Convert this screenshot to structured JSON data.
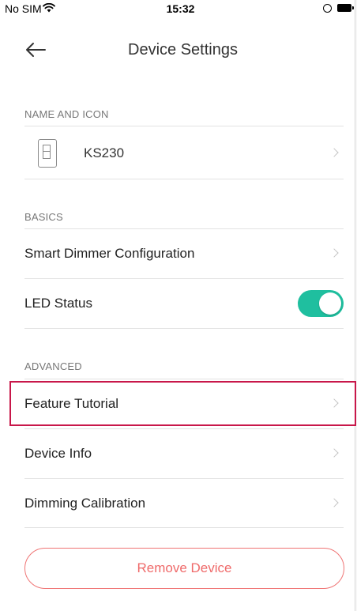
{
  "status_bar": {
    "carrier": "No SIM",
    "time": "15:32"
  },
  "header": {
    "title": "Device Settings"
  },
  "sections": {
    "name_and_icon": {
      "label": "NAME AND ICON",
      "device_name": "KS230"
    },
    "basics": {
      "label": "BASICS",
      "items": [
        {
          "label": "Smart Dimmer Configuration"
        },
        {
          "label": "LED Status",
          "toggle_on": true
        }
      ]
    },
    "advanced": {
      "label": "ADVANCED",
      "items": [
        {
          "label": "Feature Tutorial",
          "highlighted": true
        },
        {
          "label": "Device Info"
        },
        {
          "label": "Dimming Calibration"
        }
      ]
    }
  },
  "remove_button": {
    "label": "Remove Device"
  },
  "colors": {
    "toggle_on": "#1fbf9f",
    "remove_accent": "#ef6a6a",
    "highlight": "#c8174a"
  }
}
